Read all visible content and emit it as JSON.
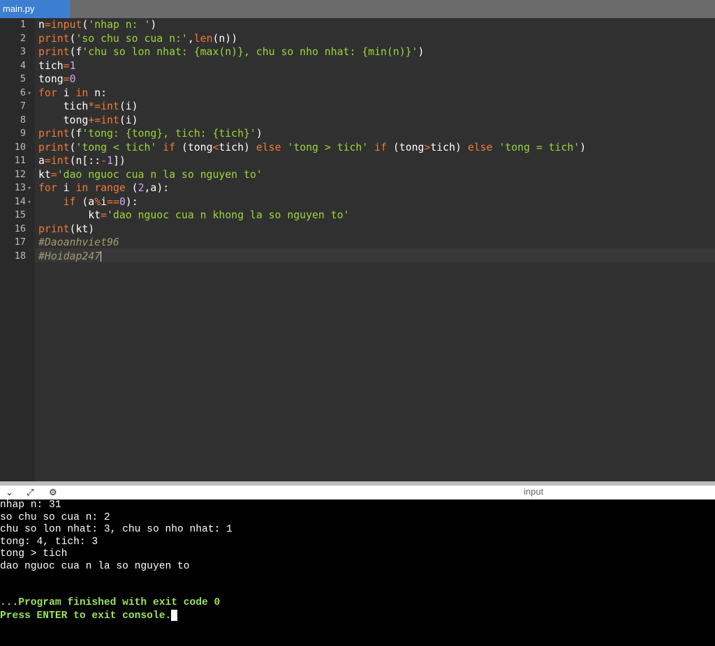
{
  "tab": {
    "title": "main.py"
  },
  "editor": {
    "line_numbers": [
      "1",
      "2",
      "3",
      "4",
      "5",
      "6",
      "7",
      "8",
      "9",
      "10",
      "11",
      "12",
      "13",
      "14",
      "15",
      "16",
      "17",
      "18"
    ],
    "fold_lines": [
      6,
      13,
      14
    ],
    "lines": [
      [
        [
          "id",
          "n"
        ],
        [
          "op",
          "="
        ],
        [
          "kw",
          "input"
        ],
        [
          "id",
          "("
        ],
        [
          "st",
          "'nhap n: '"
        ],
        [
          "id",
          ")"
        ]
      ],
      [
        [
          "kw",
          "print"
        ],
        [
          "id",
          "("
        ],
        [
          "st",
          "'so chu so cua n:'"
        ],
        [
          "id",
          ","
        ],
        [
          "kw",
          "len"
        ],
        [
          "id",
          "(n))"
        ]
      ],
      [
        [
          "kw",
          "print"
        ],
        [
          "id",
          "(f"
        ],
        [
          "st",
          "'chu so lon nhat: {max(n)}, chu so nho nhat: {min(n)}'"
        ],
        [
          "id",
          ")"
        ]
      ],
      [
        [
          "id",
          "tich"
        ],
        [
          "op",
          "="
        ],
        [
          "num",
          "1"
        ]
      ],
      [
        [
          "id",
          "tong"
        ],
        [
          "op",
          "="
        ],
        [
          "num",
          "0"
        ]
      ],
      [
        [
          "kw",
          "for"
        ],
        [
          "id",
          " i "
        ],
        [
          "kw",
          "in"
        ],
        [
          "id",
          " n:"
        ]
      ],
      [
        [
          "id",
          "    tich"
        ],
        [
          "op",
          "*="
        ],
        [
          "kw",
          "int"
        ],
        [
          "id",
          "(i)"
        ]
      ],
      [
        [
          "id",
          "    tong"
        ],
        [
          "op",
          "+="
        ],
        [
          "kw",
          "int"
        ],
        [
          "id",
          "(i)"
        ]
      ],
      [
        [
          "kw",
          "print"
        ],
        [
          "id",
          "(f"
        ],
        [
          "st",
          "'tong: {tong}, tich: {tich}'"
        ],
        [
          "id",
          ")"
        ]
      ],
      [
        [
          "kw",
          "print"
        ],
        [
          "id",
          "("
        ],
        [
          "st",
          "'tong < tich'"
        ],
        [
          "id",
          " "
        ],
        [
          "kw",
          "if"
        ],
        [
          "id",
          " (tong"
        ],
        [
          "op",
          "<"
        ],
        [
          "id",
          "tich) "
        ],
        [
          "kw",
          "else"
        ],
        [
          "id",
          " "
        ],
        [
          "st",
          "'tong > tich'"
        ],
        [
          "id",
          " "
        ],
        [
          "kw",
          "if"
        ],
        [
          "id",
          " (tong"
        ],
        [
          "op",
          ">"
        ],
        [
          "id",
          "tich) "
        ],
        [
          "kw",
          "else"
        ],
        [
          "id",
          " "
        ],
        [
          "st",
          "'tong = tich'"
        ],
        [
          "id",
          ")"
        ]
      ],
      [
        [
          "id",
          "a"
        ],
        [
          "op",
          "="
        ],
        [
          "kw",
          "int"
        ],
        [
          "id",
          "(n[::"
        ],
        [
          "op",
          "-"
        ],
        [
          "num",
          "1"
        ],
        [
          "id",
          "])"
        ]
      ],
      [
        [
          "id",
          "kt"
        ],
        [
          "op",
          "="
        ],
        [
          "st",
          "'dao nguoc cua n la so nguyen to'"
        ]
      ],
      [
        [
          "kw",
          "for"
        ],
        [
          "id",
          " i "
        ],
        [
          "kw",
          "in"
        ],
        [
          "id",
          " "
        ],
        [
          "kw",
          "range"
        ],
        [
          "id",
          " ("
        ],
        [
          "num",
          "2"
        ],
        [
          "id",
          ",a):"
        ]
      ],
      [
        [
          "id",
          "    "
        ],
        [
          "kw",
          "if"
        ],
        [
          "id",
          " (a"
        ],
        [
          "op",
          "%"
        ],
        [
          "id",
          "i"
        ],
        [
          "op",
          "=="
        ],
        [
          "num",
          "0"
        ],
        [
          "id",
          "):"
        ]
      ],
      [
        [
          "id",
          "        kt"
        ],
        [
          "op",
          "="
        ],
        [
          "st",
          "'dao nguoc cua n khong la so nguyen to'"
        ]
      ],
      [
        [
          "kw",
          "print"
        ],
        [
          "id",
          "(kt)"
        ]
      ],
      [
        [
          "cm",
          "#Daoanhviet96"
        ]
      ],
      [
        [
          "cm",
          "#Hoidap247"
        ]
      ]
    ]
  },
  "panel": {
    "title": "input",
    "icons": [
      "chevron-down-icon",
      "expand-icon",
      "settings-icon"
    ]
  },
  "console": {
    "lines": [
      "nhap n: 31",
      "so chu so cua n: 2",
      "chu so lon nhat: 3, chu so nho nhat: 1",
      "tong: 4, tich: 3",
      "tong > tich",
      "dao nguoc cua n la so nguyen to"
    ],
    "finished": "...Program finished with exit code 0",
    "press_enter": "Press ENTER to exit console."
  },
  "colors": {
    "keyword": "#f27b35",
    "string": "#9ad83a",
    "number": "#d3a4ff",
    "comment": "#a79a6f",
    "console_green": "#9be45c",
    "tab_active": "#3c7fd1"
  }
}
